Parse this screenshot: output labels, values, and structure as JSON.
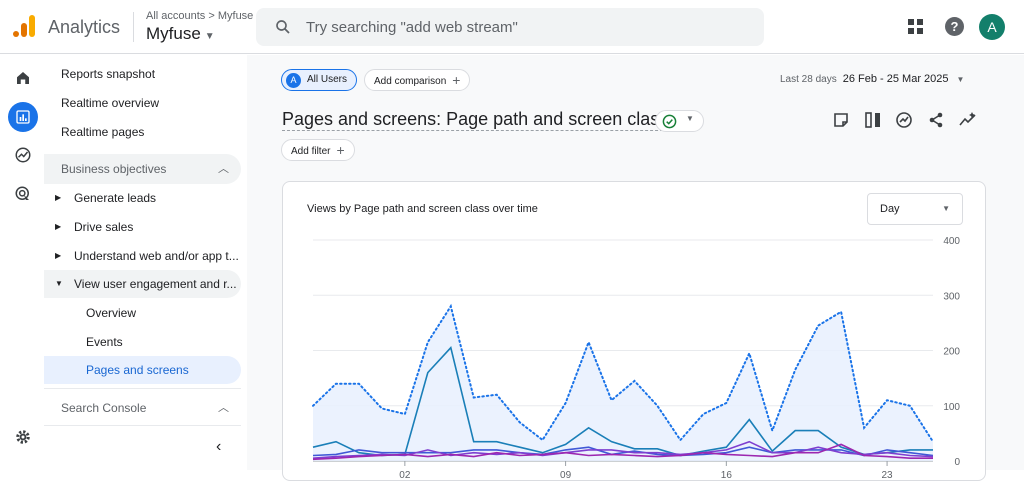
{
  "header": {
    "app_name": "Analytics",
    "breadcrumb": "All accounts > Myfuse",
    "property": "Myfuse",
    "search_placeholder": "Try searching \"add web stream\"",
    "avatar_letter": "A"
  },
  "nav": {
    "top_items": [
      "Reports snapshot",
      "Realtime overview",
      "Realtime pages"
    ],
    "section_business": "Business objectives",
    "groups": [
      "Generate leads",
      "Drive sales",
      "Understand web and/or app t...",
      "View user engagement and r..."
    ],
    "leaves": [
      "Overview",
      "Events",
      "Pages and screens"
    ],
    "section_search": "Search Console"
  },
  "toolbar": {
    "segment": "All Users",
    "segment_letter": "A",
    "add_comparison": "Add comparison",
    "date_label": "Last 28 days",
    "date_range": "26 Feb - 25 Mar 2025",
    "page_title": "Pages and screens: Page path and screen class",
    "add_filter": "Add filter"
  },
  "card": {
    "title": "Views by Page path and screen class over time",
    "granularity": "Day"
  },
  "colors": {
    "accent": "#1a73e8",
    "series": [
      "#1a73e8",
      "#1a7fb8",
      "#4059d6",
      "#7e3fd0",
      "#9c27b0"
    ]
  },
  "chart_data": {
    "type": "line",
    "x": [
      "26 Feb",
      "27 Feb",
      "28 Feb",
      "01 Mar",
      "02 Mar",
      "03 Mar",
      "04 Mar",
      "05 Mar",
      "06 Mar",
      "07 Mar",
      "08 Mar",
      "09 Mar",
      "10 Mar",
      "11 Mar",
      "12 Mar",
      "13 Mar",
      "14 Mar",
      "15 Mar",
      "16 Mar",
      "17 Mar",
      "18 Mar",
      "19 Mar",
      "20 Mar",
      "21 Mar",
      "22 Mar",
      "23 Mar",
      "24 Mar",
      "25 Mar"
    ],
    "xticks": [
      "02",
      "09",
      "16",
      "23"
    ],
    "ylim": [
      0,
      400
    ],
    "yticks": [
      0,
      100,
      200,
      300,
      400
    ],
    "series": [
      {
        "values": [
          100,
          140,
          140,
          95,
          85,
          215,
          280,
          115,
          120,
          70,
          38,
          105,
          215,
          110,
          145,
          100,
          38,
          85,
          105,
          195,
          55,
          165,
          245,
          270,
          60,
          110,
          100,
          35
        ],
        "style": "dotted-area"
      },
      {
        "values": [
          25,
          35,
          15,
          10,
          12,
          160,
          205,
          35,
          35,
          25,
          15,
          30,
          60,
          35,
          22,
          22,
          10,
          18,
          25,
          75,
          18,
          55,
          55,
          25,
          12,
          15,
          20,
          20
        ]
      },
      {
        "values": [
          10,
          12,
          20,
          15,
          15,
          15,
          15,
          20,
          20,
          15,
          12,
          20,
          25,
          12,
          18,
          12,
          10,
          12,
          15,
          25,
          15,
          20,
          20,
          20,
          10,
          20,
          15,
          10
        ]
      },
      {
        "values": [
          5,
          8,
          10,
          12,
          10,
          20,
          10,
          15,
          12,
          15,
          10,
          15,
          20,
          20,
          15,
          15,
          12,
          15,
          20,
          35,
          15,
          15,
          25,
          15,
          12,
          15,
          10,
          8
        ]
      },
      {
        "values": [
          3,
          5,
          8,
          10,
          12,
          8,
          12,
          8,
          15,
          10,
          12,
          15,
          10,
          12,
          10,
          8,
          10,
          15,
          12,
          10,
          8,
          15,
          15,
          30,
          10,
          8,
          5,
          5
        ]
      }
    ]
  }
}
